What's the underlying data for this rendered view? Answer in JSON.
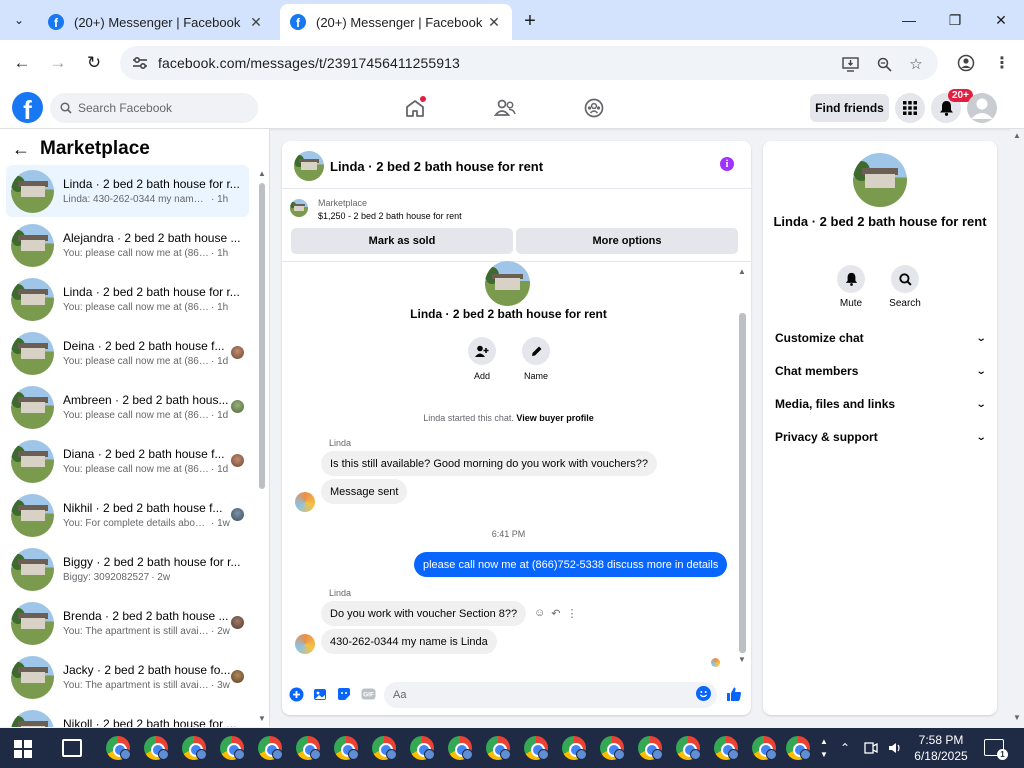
{
  "browser": {
    "tabs": [
      {
        "title": "(20+) Messenger | Facebook",
        "active": false
      },
      {
        "title": "(20+) Messenger | Facebook",
        "active": true
      }
    ],
    "url": "facebook.com/messages/t/23917456411255913"
  },
  "fb": {
    "logo": "f",
    "search_placeholder": "Search Facebook",
    "find_friends": "Find friends",
    "notifications_badge": "20+"
  },
  "left": {
    "title": "Marketplace",
    "conversations": [
      {
        "name": "Linda · 2 bed 2 bath house for r...",
        "snippet": "Linda: 430-262-0344 my name is L...",
        "time": "· 1h"
      },
      {
        "name": "Alejandra · 2 bed 2 bath house ...",
        "snippet": "You: please call now me at (866)75...",
        "time": "· 1h"
      },
      {
        "name": "Linda · 2 bed 2 bath house for r...",
        "snippet": "You: please call now me at (866)75...",
        "time": "· 1h"
      },
      {
        "name": "Deina · 2 bed 2 bath house f...",
        "snippet": "You: please call now me at (866...",
        "time": "· 1d"
      },
      {
        "name": "Ambreen · 2 bed 2 bath hous...",
        "snippet": "You: please call now me at (866...",
        "time": "· 1d"
      },
      {
        "name": "Diana · 2 bed 2 bath house f...",
        "snippet": "You: please call now me at (866...",
        "time": "· 1d"
      },
      {
        "name": "Nikhil · 2 bed 2 bath house f...",
        "snippet": "You: For complete details about...",
        "time": "· 1w"
      },
      {
        "name": "Biggy · 2 bed 2 bath house for r...",
        "snippet": "Biggy: 3092082527",
        "time": "· 2w"
      },
      {
        "name": "Brenda · 2 bed 2 bath house ...",
        "snippet": "You: The apartment is still avail...",
        "time": "· 2w"
      },
      {
        "name": "Jacky · 2 bed 2 bath house fo...",
        "snippet": "You: The apartment is still avail...",
        "time": "· 3w"
      },
      {
        "name": "Nikoll · 2 bed 2 bath house for ...",
        "snippet": "",
        "time": ""
      }
    ]
  },
  "chat": {
    "header_title": "Linda · 2 bed 2 bath house for rent",
    "marketplace_label": "Marketplace",
    "listing": "$1,250 - 2 bed 2 bath house for rent",
    "mark_sold": "Mark as sold",
    "more_options": "More options",
    "thread_title": "Linda · 2 bed 2 bath house for rent",
    "add_label": "Add",
    "name_label": "Name",
    "started_note": "Linda started this chat.",
    "view_profile": "View buyer profile",
    "messages": [
      {
        "sender": "Linda",
        "text": "Is this still available? Good morning do you work with vouchers??"
      },
      {
        "text": "Message sent"
      },
      {
        "timestamp": "6:41 PM"
      },
      {
        "text": "please call now me at (866)752-5338 discuss more in details",
        "outgoing": true
      },
      {
        "sender": "Linda",
        "text": "Do you work with voucher Section 8??"
      },
      {
        "text": "430-262-0344 my name is Linda"
      }
    ],
    "composer_placeholder": "Aa"
  },
  "right": {
    "title": "Linda · 2 bed 2 bath house for rent",
    "mute": "Mute",
    "search": "Search",
    "sections": [
      "Customize chat",
      "Chat members",
      "Media, files and links",
      "Privacy & support"
    ]
  },
  "taskbar": {
    "time": "7:58 PM",
    "date": "6/18/2025",
    "notifications": "1"
  }
}
